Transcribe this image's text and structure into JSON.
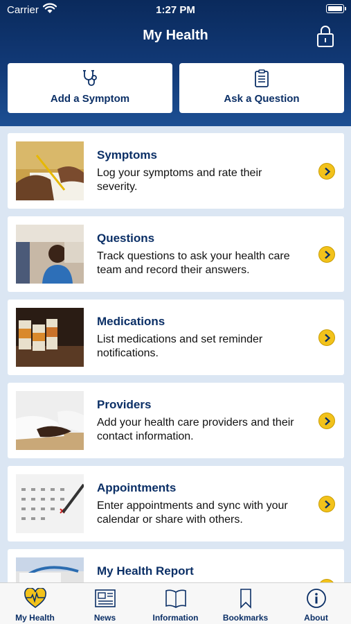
{
  "status_bar": {
    "carrier": "Carrier",
    "time": "1:27 PM"
  },
  "header": {
    "title": "My Health"
  },
  "quick_actions": [
    {
      "label": "Add a Symptom",
      "icon": "stethoscope-icon"
    },
    {
      "label": "Ask a Question",
      "icon": "clipboard-icon"
    }
  ],
  "cards": [
    {
      "title": "Symptoms",
      "description": "Log your symptoms and rate their severity."
    },
    {
      "title": "Questions",
      "description": "Track questions to ask your health care team and record their answers."
    },
    {
      "title": "Medications",
      "description": "List medications and set reminder notifications."
    },
    {
      "title": "Providers",
      "description": "Add your health care providers and their contact information."
    },
    {
      "title": "Appointments",
      "description": "Enter appointments and sync with your calendar or share with others."
    },
    {
      "title": "My Health Report",
      "description": ""
    }
  ],
  "tabs": [
    {
      "label": "My Health",
      "icon": "heart-pulse-icon",
      "active": true
    },
    {
      "label": "News",
      "icon": "newspaper-icon"
    },
    {
      "label": "Information",
      "icon": "book-icon"
    },
    {
      "label": "Bookmarks",
      "icon": "bookmark-icon"
    },
    {
      "label": "About",
      "icon": "info-icon"
    }
  ],
  "colors": {
    "header_top": "#0a2a5c",
    "header_bottom": "#1d4f93",
    "accent_yellow": "#f2c21b",
    "text_navy": "#0b2f66",
    "background": "#dbe6f3"
  }
}
